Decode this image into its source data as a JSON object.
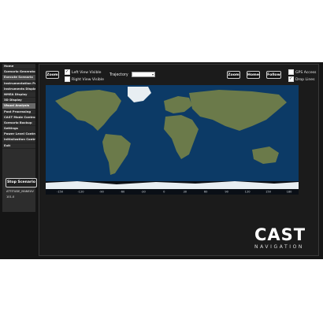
{
  "sidebar": {
    "menu": [
      {
        "label": "Home",
        "section": false
      },
      {
        "label": "Scenario Generator",
        "section": false
      },
      {
        "label": "Execute Scenario",
        "section": false,
        "active": true
      },
      {
        "label": "Instrumentation Port",
        "section": false
      },
      {
        "label": "Instruments Display",
        "section": false
      },
      {
        "label": "NMEA Display",
        "section": false
      },
      {
        "label": "3D Display",
        "section": false
      },
      {
        "label": "Visual Analysis",
        "section": true
      },
      {
        "label": "Post Processing",
        "section": false
      },
      {
        "label": "CAST Mode Control",
        "section": false
      },
      {
        "label": "Scenario Backup",
        "section": false
      },
      {
        "label": "Settings",
        "section": false
      },
      {
        "label": "Power Level Control",
        "section": false
      },
      {
        "label": "Initialization Control",
        "section": false
      },
      {
        "label": "Exit",
        "section": false
      }
    ],
    "stop_label": "Stop Scenario",
    "scenario_name": "ATTITUDE_MANEUV",
    "scenario_value": "101.0"
  },
  "toolbar": {
    "zoom_left": "Zoom",
    "left_view": "Left View Visible",
    "right_view": "Right View Visible",
    "left_view_checked": true,
    "right_view_checked": false,
    "trajectory_label": "Trajectory",
    "trajectory_value": "",
    "zoom_right": "Zoom",
    "home": "Home",
    "follow": "Follow",
    "gps_access": "GPS Access",
    "drop_lines": "Drop Lines",
    "gps_access_checked": false,
    "drop_lines_checked": true
  },
  "map": {
    "lon_ticks": [
      "-150",
      "-120",
      "-90",
      "-60",
      "-30",
      "0",
      "30",
      "60",
      "90",
      "120",
      "150",
      "180"
    ],
    "colors": {
      "ocean": "#0c3a66",
      "land": "#6b7a4a",
      "ice": "#e8eef2"
    }
  },
  "logo": {
    "main": "CAST",
    "sub": "NAVIGATION"
  }
}
